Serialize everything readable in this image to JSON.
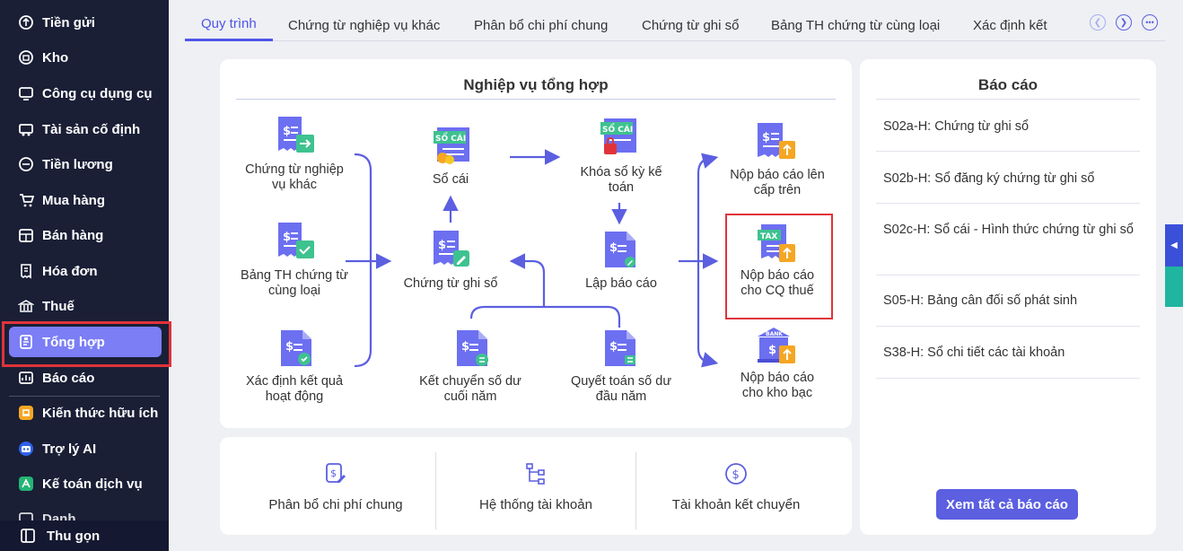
{
  "sidebar": {
    "items": [
      {
        "label": "Tiền gửi",
        "icon": "deposit-icon"
      },
      {
        "label": "Kho",
        "icon": "warehouse-icon"
      },
      {
        "label": "Công cụ dụng cụ",
        "icon": "tools-icon"
      },
      {
        "label": "Tài sản cố định",
        "icon": "assets-icon"
      },
      {
        "label": "Tiền lương",
        "icon": "salary-icon"
      },
      {
        "label": "Mua hàng",
        "icon": "cart-icon"
      },
      {
        "label": "Bán hàng",
        "icon": "sales-icon"
      },
      {
        "label": "Hóa đơn",
        "icon": "invoice-icon"
      },
      {
        "label": "Thuế",
        "icon": "tax-icon"
      },
      {
        "label": "Tổng hợp",
        "icon": "summary-icon",
        "active": true
      },
      {
        "label": "Báo cáo",
        "icon": "report-icon"
      },
      {
        "label": "Kiến thức hữu ích",
        "icon": "knowledge-icon"
      },
      {
        "label": "Trợ lý AI",
        "icon": "ai-icon"
      },
      {
        "label": "Kế toán dịch vụ",
        "icon": "service-icon"
      }
    ],
    "partial_label": "Danh...",
    "collapse_label": "Thu gọn"
  },
  "tabs": [
    {
      "label": "Quy trình",
      "active": true
    },
    {
      "label": "Chứng từ nghiệp vụ khác"
    },
    {
      "label": "Phân bổ chi phí chung"
    },
    {
      "label": "Chứng từ ghi sổ"
    },
    {
      "label": "Bảng TH chứng từ cùng loại"
    },
    {
      "label": "Xác định kết"
    }
  ],
  "workflow": {
    "title": "Nghiệp vụ tổng hợp",
    "nodes": {
      "ct_nv_khac": "Chứng từ nghiệp vụ khác",
      "bang_th": "Bảng TH chứng từ cùng loại",
      "xd_kq": "Xác định kết quả hoạt động",
      "so_cai": "Sổ cái",
      "ct_ghi_so": "Chứng từ ghi sổ",
      "ket_chuyen": "Kết chuyển số dư cuối năm",
      "khoa_so": "Khóa sổ kỳ kế toán",
      "lap_bc": "Lập báo cáo",
      "quyet_toan": "Quyết toán số dư đầu năm",
      "nop_cap_tren": "Nộp báo cáo lên cấp trên",
      "nop_cq_thue": "Nộp báo cáo cho CQ thuế",
      "nop_kho_bac": "Nộp báo cáo cho kho bạc"
    },
    "badges": {
      "so_cai": "SỔ CÁI",
      "tax": "TAX",
      "bank": "BANK"
    }
  },
  "reports": {
    "title": "Báo cáo",
    "items": [
      "S02a-H: Chứng từ ghi sổ",
      "S02b-H: Sổ đăng ký chứng từ ghi sổ",
      "S02c-H: Sổ cái - Hình thức chứng từ ghi sổ",
      "S05-H: Bảng cân đối số phát sinh",
      "S38-H: Sổ chi tiết các tài khoản"
    ],
    "see_all": "Xem tất cả báo cáo"
  },
  "shortcuts": [
    {
      "label": "Phân bổ chi phí chung",
      "icon": "allocation-icon"
    },
    {
      "label": "Hệ thống tài khoản",
      "icon": "account-tree-icon"
    },
    {
      "label": "Tài khoản kết chuyển",
      "icon": "dollar-circle-icon"
    }
  ],
  "colors": {
    "accent": "#5b5fe0",
    "sidebar_bg": "#1a1f36",
    "active_item": "#7b7ef4",
    "highlight": "#e0333a"
  }
}
